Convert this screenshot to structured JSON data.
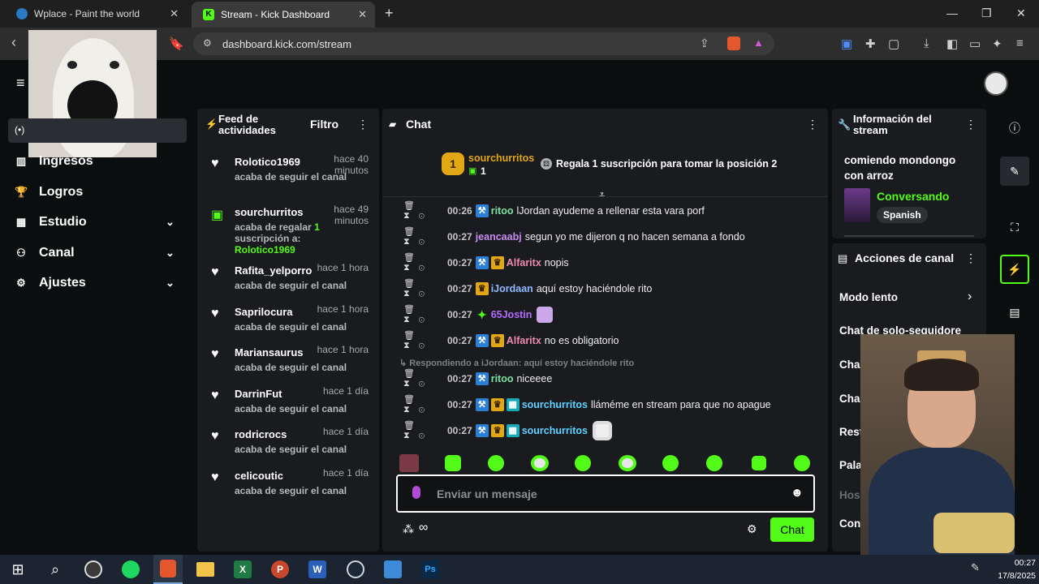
{
  "browser": {
    "tabs": [
      {
        "title": "Wplace - Paint the world"
      },
      {
        "title": "Stream - Kick Dashboard"
      }
    ],
    "url": "dashboard.kick.com/stream",
    "new_tab": "+"
  },
  "sidebar": {
    "items": [
      {
        "label": "Ingresos",
        "icon": "chart-icon"
      },
      {
        "label": "Logros",
        "icon": "trophy-icon"
      },
      {
        "label": "Estudio",
        "icon": "layout-icon",
        "expandable": true
      },
      {
        "label": "Canal",
        "icon": "users-icon",
        "expandable": true
      },
      {
        "label": "Ajustes",
        "icon": "gear-icon",
        "expandable": true
      }
    ]
  },
  "feed": {
    "title": "Feed de actividades",
    "filter_label": "Filtro",
    "items": [
      {
        "user": "Rolotico1969",
        "time": "hace 40 minutos",
        "desc": "acaba de seguir el canal",
        "type": "follow"
      },
      {
        "user": "sourchurritos",
        "time": "hace 49 minutos",
        "desc_prefix": "acaba de regalar ",
        "gift_count": "1",
        "desc_mid": "suscripción a: ",
        "gift_target": "Rolotico1969",
        "type": "gift"
      },
      {
        "user": "Rafita_yelporro",
        "time": "hace 1 hora",
        "desc": "acaba de seguir el canal",
        "type": "follow"
      },
      {
        "user": "Saprilocura",
        "time": "hace 1 hora",
        "desc": "acaba de seguir el canal",
        "type": "follow"
      },
      {
        "user": "Mariansaurus",
        "time": "hace 1 hora",
        "desc": "acaba de seguir el canal",
        "type": "follow"
      },
      {
        "user": "DarrinFut",
        "time": "hace 1 día",
        "desc": "acaba de seguir el canal",
        "type": "follow"
      },
      {
        "user": "rodricrocs",
        "time": "hace 1 día",
        "desc": "acaba de seguir el canal",
        "type": "follow"
      },
      {
        "user": "celicoutic",
        "time": "hace 1 día",
        "desc": "acaba de seguir el canal",
        "type": "follow"
      }
    ]
  },
  "chat": {
    "title": "Chat",
    "leader": {
      "rank": "1",
      "user": "sourchurritos",
      "count": "1",
      "cta": "Regala 1 suscripción para tomar la posición 2"
    },
    "messages": [
      {
        "time": "00:26",
        "user": "ritoo",
        "color": "#7ee3a0",
        "badges": [
          "b-blue"
        ],
        "text": "lJordan ayudeme a rellenar esta vara porf"
      },
      {
        "time": "00:27",
        "user": "jeancaabj",
        "color": "#c98cf0",
        "badges": [],
        "text": "segun yo me dijeron q no hacen semana a fondo"
      },
      {
        "time": "00:27",
        "user": "Alfaritx",
        "color": "#f08ab0",
        "badges": [
          "b-blue",
          "b-gold"
        ],
        "text": "nopis"
      },
      {
        "time": "00:27",
        "user": "iJordaan",
        "color": "#8fb8ff",
        "badges": [
          "b-gold"
        ],
        "text": "aquí estoy haciéndole rito"
      },
      {
        "time": "00:27",
        "user": "65Jostin",
        "color": "#b86cff",
        "badges": [
          "star"
        ],
        "text": "",
        "emote": true
      },
      {
        "time": "00:27",
        "user": "Alfaritx",
        "color": "#f08ab0",
        "badges": [
          "b-blue",
          "b-gold"
        ],
        "text": "no es obligatorio"
      },
      {
        "time": "00:27",
        "user": "ritoo",
        "color": "#7ee3a0",
        "badges": [
          "b-blue"
        ],
        "text": "niceeee",
        "reply": "Respondiendo a iJordaan: aquí estoy haciéndole rito"
      },
      {
        "time": "00:27",
        "user": "sourchurritos",
        "color": "#5fd3ff",
        "badges": [
          "b-blue",
          "b-gold",
          "b-teal"
        ],
        "text": "lláméme en stream para que no apague"
      },
      {
        "time": "00:27",
        "user": "sourchurritos",
        "color": "#5fd3ff",
        "badges": [
          "b-blue",
          "b-gold",
          "b-teal"
        ],
        "text": "",
        "emote": true
      }
    ],
    "input_placeholder": "Enviar un mensaje",
    "send_label": "Chat"
  },
  "stream_info": {
    "title": "Información del stream",
    "stream_title": "comiendo mondongo con arroz",
    "category": "Conversando",
    "language": "Spanish"
  },
  "channel_actions": {
    "title": "Acciones de canal",
    "items": [
      "Modo lento",
      "Chat de solo-seguidore",
      "Cha",
      "Cha",
      "Rest",
      "Pala",
      "Hos",
      "Con"
    ]
  },
  "taskbar": {
    "time": "00:27",
    "date": "17/8/2025"
  },
  "colors": {
    "accent": "#53fc18",
    "panel": "#191b1f",
    "background": "#0b0e0f"
  }
}
